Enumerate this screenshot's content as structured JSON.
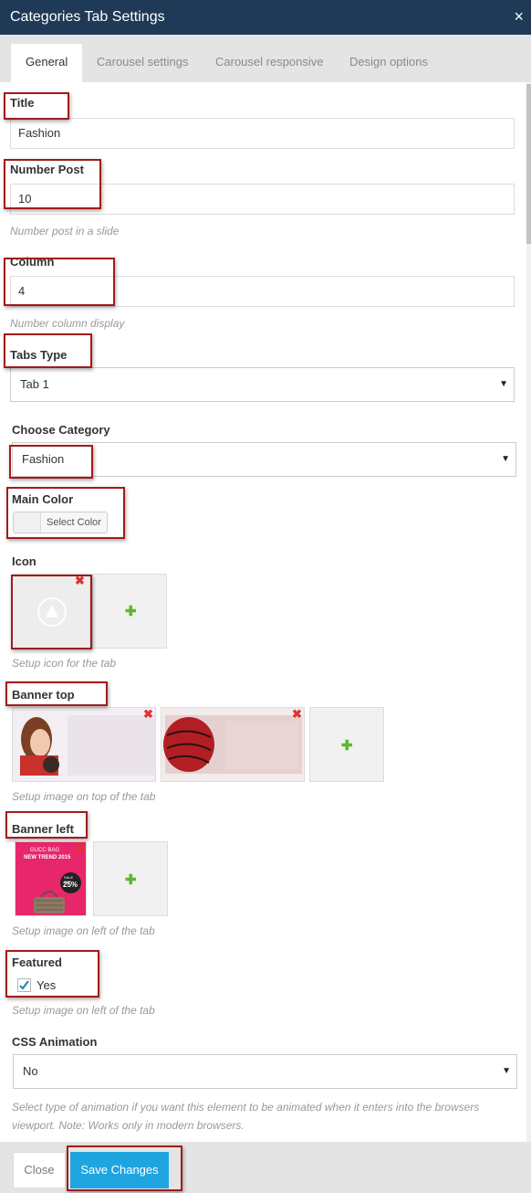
{
  "dialog": {
    "title": "Categories Tab Settings",
    "close_glyph": "×"
  },
  "tabs": [
    {
      "label": "General",
      "active": true
    },
    {
      "label": "Carousel settings",
      "active": false
    },
    {
      "label": "Carousel responsive",
      "active": false
    },
    {
      "label": "Design options",
      "active": false
    }
  ],
  "fields": {
    "title": {
      "label": "Title",
      "value": "Fashion"
    },
    "number_post": {
      "label": "Number Post",
      "value": "10",
      "hint": "Number post in a slide"
    },
    "column": {
      "label": "Column",
      "value": "4",
      "hint": "Number column display"
    },
    "tabs_type": {
      "label": "Tabs Type",
      "selected": "Tab 1"
    },
    "choose_category": {
      "label": "Choose Category",
      "selected": "Fashion"
    },
    "main_color": {
      "label": "Main Color",
      "button": "Select Color"
    },
    "icon": {
      "label": "Icon",
      "hint": "Setup icon for the tab"
    },
    "banner_top": {
      "label": "Banner top",
      "hint": "Setup image on top of the tab"
    },
    "banner_left": {
      "label": "Banner left",
      "hint": "Setup image on left of the tab",
      "image_text": {
        "line1": "GUCC BAG",
        "line2": "NEW TREND 2015",
        "sale": "SALE OFF",
        "percent": "25%"
      }
    },
    "featured": {
      "label": "Featured",
      "checkbox_label": "Yes",
      "checked": true,
      "hint": "Setup image on left of the tab"
    },
    "css_animation": {
      "label": "CSS Animation",
      "selected": "No",
      "hint": "Select type of animation if you want this element to be animated when it enters into the browsers viewport. Note: Works only in modern browsers."
    }
  },
  "footer": {
    "close_label": "Close",
    "save_label": "Save Changes"
  },
  "colors": {
    "header_bg": "#1f3a57",
    "accent": "#1ea5e0",
    "highlight_box": "#a31a1a",
    "add_icon": "#5cb82e",
    "remove_icon": "#dd3333"
  }
}
